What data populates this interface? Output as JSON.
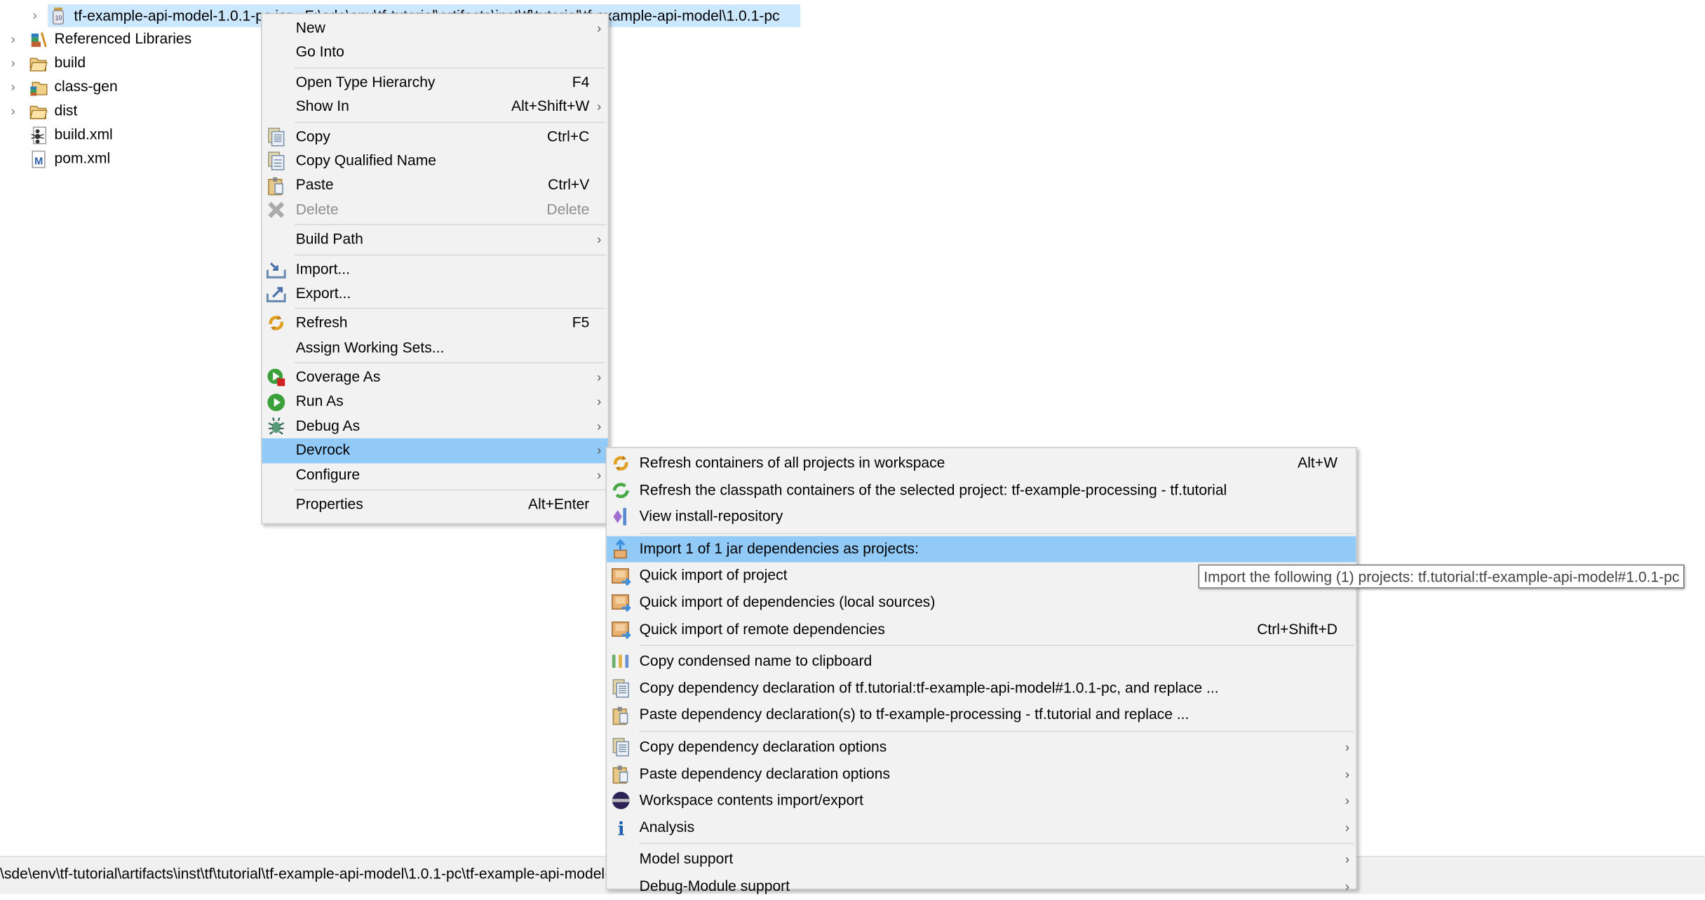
{
  "tree": {
    "selected_item": {
      "label": "tf-example-api-model-1.0.1-pc.jar - F:\\sde\\env\\tf-tutorial\\artifacts\\inst\\tf\\tutorial\\tf-example-api-model\\1.0.1-pc",
      "icon": "jar-icon"
    },
    "items": [
      {
        "label": "Referenced Libraries",
        "icon": "library-icon",
        "expandable": true
      },
      {
        "label": "build",
        "icon": "folder-icon",
        "expandable": true
      },
      {
        "label": "class-gen",
        "icon": "source-folder-icon",
        "expandable": true
      },
      {
        "label": "dist",
        "icon": "folder-icon",
        "expandable": true
      },
      {
        "label": "build.xml",
        "icon": "ant-file-icon",
        "expandable": false
      },
      {
        "label": "pom.xml",
        "icon": "maven-file-icon",
        "expandable": false
      }
    ]
  },
  "context_menu": [
    {
      "label": "New",
      "submenu": true
    },
    {
      "label": "Go Into"
    },
    {
      "sep": true
    },
    {
      "label": "Open Type Hierarchy",
      "shortcut": "F4"
    },
    {
      "label": "Show In",
      "shortcut": "Alt+Shift+W",
      "submenu": true
    },
    {
      "sep": true
    },
    {
      "label": "Copy",
      "shortcut": "Ctrl+C",
      "icon": "copy-icon"
    },
    {
      "label": "Copy Qualified Name",
      "icon": "copy-qualified-icon"
    },
    {
      "label": "Paste",
      "shortcut": "Ctrl+V",
      "icon": "paste-icon"
    },
    {
      "label": "Delete",
      "shortcut": "Delete",
      "icon": "delete-icon",
      "disabled": true
    },
    {
      "sep": true
    },
    {
      "label": "Build Path",
      "submenu": true
    },
    {
      "sep": true
    },
    {
      "label": "Import...",
      "icon": "import-icon"
    },
    {
      "label": "Export...",
      "icon": "export-icon"
    },
    {
      "sep": true
    },
    {
      "label": "Refresh",
      "shortcut": "F5",
      "icon": "refresh-icon"
    },
    {
      "label": "Assign Working Sets..."
    },
    {
      "sep": true
    },
    {
      "label": "Coverage As",
      "icon": "coverage-icon",
      "submenu": true
    },
    {
      "label": "Run As",
      "icon": "run-icon",
      "submenu": true
    },
    {
      "label": "Debug As",
      "icon": "debug-icon",
      "submenu": true
    },
    {
      "label": "Devrock",
      "submenu": true,
      "highlighted": true
    },
    {
      "label": "Configure",
      "submenu": true
    },
    {
      "sep": true
    },
    {
      "label": "Properties",
      "shortcut": "Alt+Enter"
    }
  ],
  "devrock_submenu": [
    {
      "label": "Refresh containers of all projects in workspace",
      "shortcut": "Alt+W",
      "icon": "refresh-icon"
    },
    {
      "label": "Refresh the classpath containers of the selected project: tf-example-processing - tf.tutorial",
      "icon": "refresh-green-icon"
    },
    {
      "label": "View install-repository",
      "icon": "repository-icon"
    },
    {
      "sep": true
    },
    {
      "label": "Import 1 of 1 jar dependencies as projects:",
      "icon": "import-project-icon",
      "highlighted": true
    },
    {
      "label": "Quick import of project",
      "icon": "quick-import-icon"
    },
    {
      "label": "Quick import of dependencies (local sources)",
      "icon": "quick-import-icon"
    },
    {
      "label": "Quick import of remote dependencies",
      "shortcut": "Ctrl+Shift+D",
      "icon": "quick-import-icon"
    },
    {
      "sep": true
    },
    {
      "label": "Copy condensed name to clipboard",
      "icon": "condensed-name-icon"
    },
    {
      "label": "Copy dependency declaration of tf.tutorial:tf-example-api-model#1.0.1-pc, and replace ...",
      "icon": "copy-icon"
    },
    {
      "label": "Paste dependency declaration(s) to tf-example-processing - tf.tutorial and replace ...",
      "icon": "paste-icon"
    },
    {
      "sep": true
    },
    {
      "label": "Copy dependency declaration options",
      "icon": "copy-icon",
      "submenu": true
    },
    {
      "label": "Paste dependency declaration options",
      "icon": "paste-icon",
      "submenu": true
    },
    {
      "label": "Workspace contents import/export",
      "icon": "eclipse-icon",
      "submenu": true
    },
    {
      "label": "Analysis",
      "icon": "info-icon",
      "submenu": true
    },
    {
      "sep": true
    },
    {
      "label": "Model support",
      "submenu": true
    },
    {
      "label": "Debug-Module support",
      "submenu": true
    }
  ],
  "tooltip": "Import the following (1) projects: tf.tutorial:tf-example-api-model#1.0.1-pc",
  "status_bar": "\\sde\\env\\tf-tutorial\\artifacts\\inst\\tf\\tutorial\\tf-example-api-model\\1.0.1-pc\\tf-example-api-model-1.0.1-pc.jar",
  "glyphs": {
    "chevron_right": "›",
    "tree_chevron": "›"
  },
  "colors": {
    "menu_bg": "#f2f2f2",
    "highlight": "#91c9f7",
    "selection": "#cce8ff"
  }
}
